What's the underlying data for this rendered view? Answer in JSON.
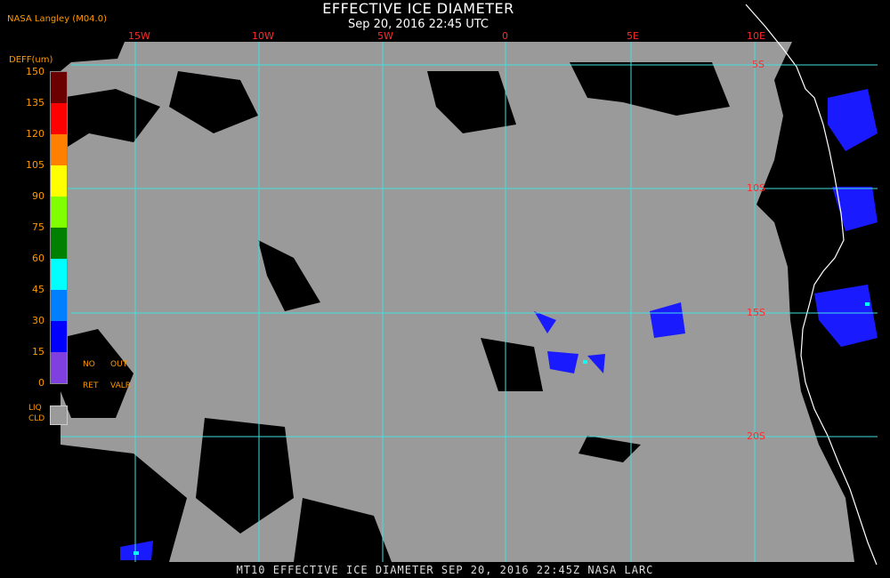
{
  "header": {
    "title": "EFFECTIVE ICE DIAMETER",
    "subtitle": "Sep 20, 2016 22:45 UTC",
    "source": "NASA Langley (M04.0)"
  },
  "legend": {
    "title": "DEFF(um)",
    "ticks": [
      "150",
      "135",
      "120",
      "105",
      "90",
      "75",
      "60",
      "45",
      "30",
      "15",
      "0"
    ],
    "colors": [
      "#6b0000",
      "#ff0000",
      "#ff8000",
      "#ffff00",
      "#80ff00",
      "#008000",
      "#00ffff",
      "#0080ff",
      "#0000ff",
      "#8040e0"
    ],
    "notes": [
      "NO",
      "OUT",
      "RET",
      "VALR"
    ],
    "liq_label_1": "LIQ",
    "liq_label_2": "CLD",
    "liq_color": "#9a9a9a"
  },
  "map": {
    "longitude_labels": [
      "15W",
      "10W",
      "5W",
      "0",
      "5E",
      "10E"
    ],
    "latitude_labels": [
      "5S",
      "10S",
      "15S",
      "20S"
    ],
    "grid_color": "#40e0e0",
    "ocean_color": "#9a9a9a",
    "land_color": "#000000",
    "coast_color": "#ffffff"
  },
  "footer": {
    "text": "MT10  EFFECTIVE ICE DIAMETER  SEP 20, 2016 22:45Z  NASA LARC"
  }
}
